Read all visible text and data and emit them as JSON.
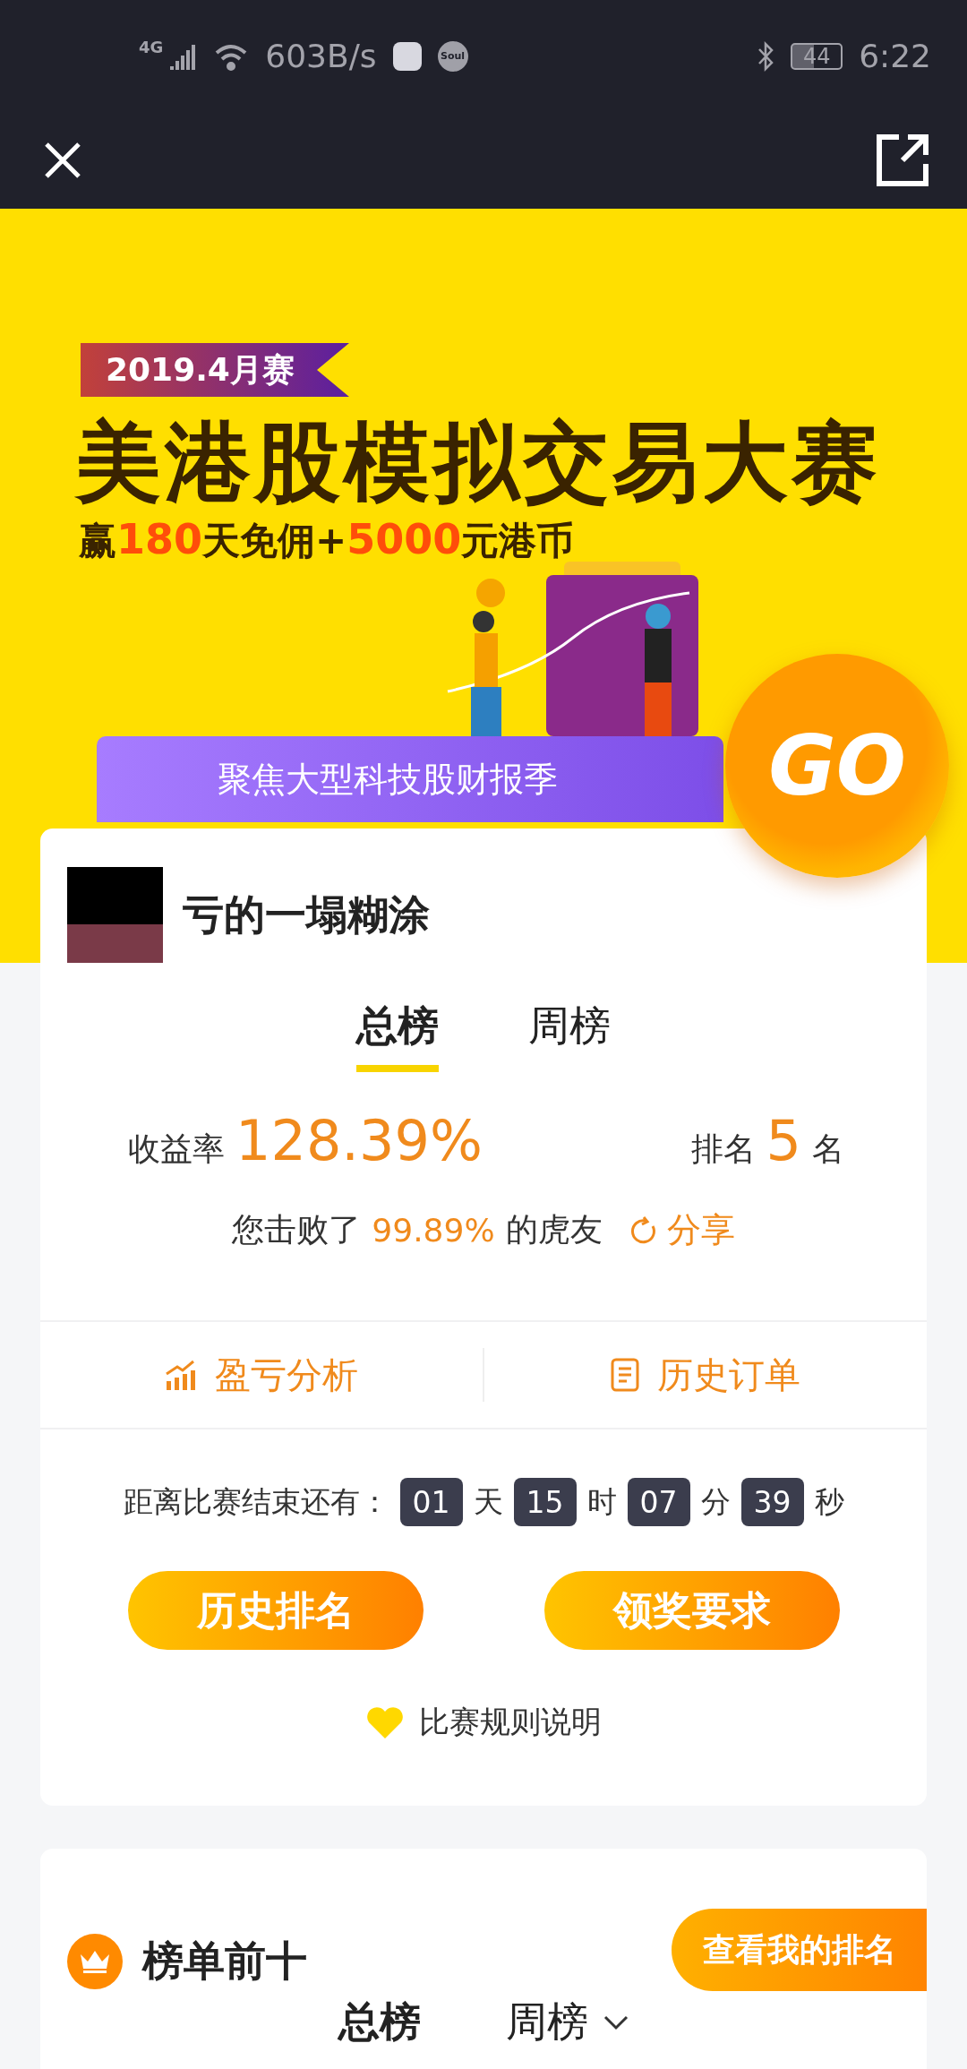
{
  "status_bar": {
    "network": "4G",
    "speed": "603B/s",
    "app_badge": "Soul",
    "battery": "44",
    "time": "6:22"
  },
  "banner": {
    "ribbon": "2019.4月赛",
    "title": "美港股模拟交易大赛",
    "subtitle": [
      {
        "text": "赢",
        "highlight": false
      },
      {
        "text": "180",
        "highlight": true
      },
      {
        "text": "天免佣+",
        "highlight": false
      },
      {
        "text": "5000",
        "highlight": true
      },
      {
        "text": "元港币",
        "highlight": false
      }
    ],
    "theme": "聚焦大型科技股财报季",
    "go": "GO"
  },
  "profile": {
    "name": "亏的一塌糊涂",
    "tabs": [
      {
        "label": "总榜",
        "selected": true
      },
      {
        "label": "周榜",
        "selected": false
      }
    ],
    "return_label": "收益率",
    "return_value": "128.39%",
    "rank_label": "排名",
    "rank_value": "5",
    "rank_unit": "名",
    "defeat_prefix": "您击败了",
    "defeat_value": "99.89%",
    "defeat_suffix": "的虎友",
    "share": "分享",
    "links": [
      {
        "kind": "chart",
        "label": "盈亏分析"
      },
      {
        "kind": "list",
        "label": "历史订单"
      }
    ],
    "countdown_label": "距离比赛结束还有：",
    "countdown": [
      {
        "value": "01",
        "unit": "天"
      },
      {
        "value": "15",
        "unit": "时"
      },
      {
        "value": "07",
        "unit": "分"
      },
      {
        "value": "39",
        "unit": "秒"
      }
    ],
    "buttons": [
      "历史排名",
      "领奖要求"
    ],
    "rules": "比赛规则说明"
  },
  "leaderboard": {
    "title": "榜单前十",
    "my_rank": "查看我的排名",
    "tabs": [
      {
        "label": "总榜",
        "selected": true,
        "menu": false
      },
      {
        "label": "周榜",
        "selected": false,
        "menu": true
      }
    ]
  }
}
